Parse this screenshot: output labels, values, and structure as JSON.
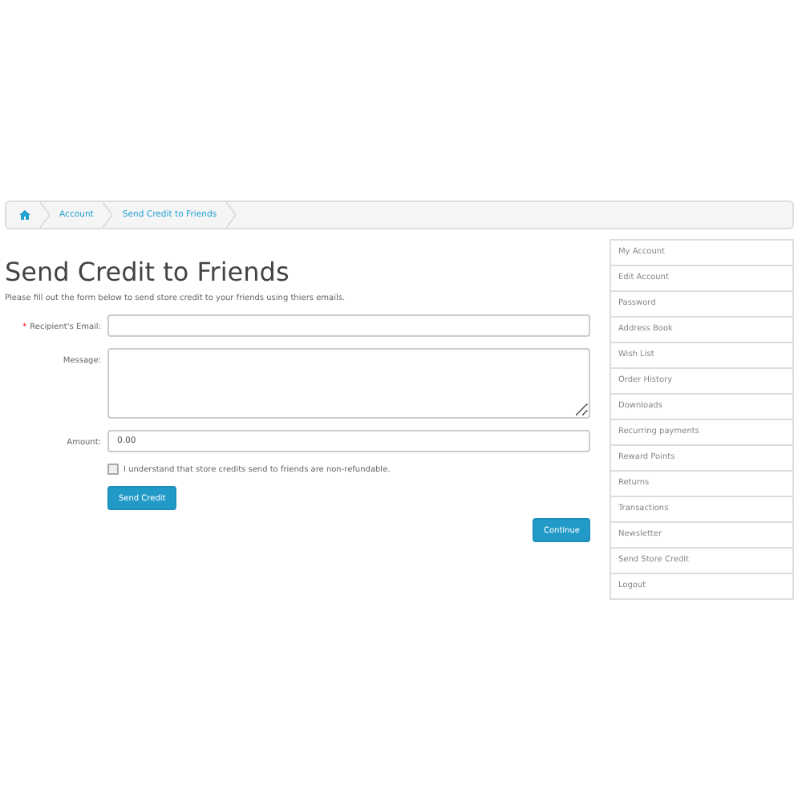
{
  "breadcrumb": [
    {
      "kind": "home"
    },
    {
      "kind": "link",
      "label": "Account"
    },
    {
      "kind": "link",
      "label": "Send Credit to Friends"
    }
  ],
  "title": "Send Credit to Friends",
  "intro": "Please fill out the form below to send store credit to your friends using thiers emails.",
  "fields": [
    {
      "kind": "input",
      "marker": "*",
      "label": "Recipient's Email:"
    },
    {
      "kind": "textarea",
      "label": "Message:"
    },
    {
      "kind": "input",
      "label": "Amount:",
      "value": "0.00"
    }
  ],
  "agree": {
    "label": "I understand that store credits send to friends are non-refundable.",
    "checked": false
  },
  "send_button": "Send Credit",
  "continue_button": "Continue",
  "sidebar": {
    "items": [
      "My Account",
      "Edit Account",
      "Password",
      "Address Book",
      "Wish List",
      "Order History",
      "Downloads",
      "Recurring payments",
      "Reward Points",
      "Returns",
      "Transactions",
      "Newsletter",
      "Send Store Credit",
      "Logout"
    ]
  }
}
